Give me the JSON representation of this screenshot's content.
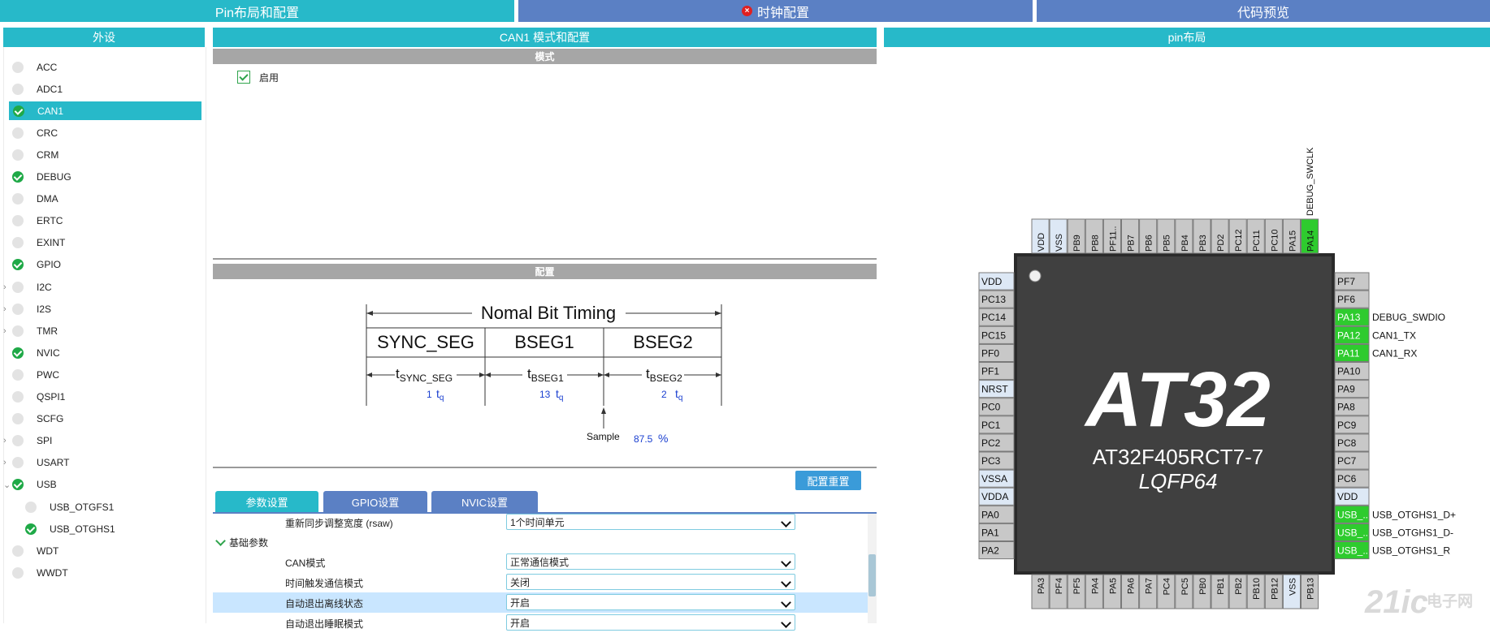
{
  "top_tabs": {
    "pin_layout": "Pin布局和配置",
    "clock_config": "时钟配置",
    "code_preview": "代码预览"
  },
  "left_panel": {
    "title": "外设",
    "items": [
      {
        "label": "ACC",
        "status": "none"
      },
      {
        "label": "ADC1",
        "status": "none"
      },
      {
        "label": "CAN1",
        "status": "ok"
      },
      {
        "label": "CRC",
        "status": "none"
      },
      {
        "label": "CRM",
        "status": "none"
      },
      {
        "label": "DEBUG",
        "status": "ok"
      },
      {
        "label": "DMA",
        "status": "none"
      },
      {
        "label": "ERTC",
        "status": "none"
      },
      {
        "label": "EXINT",
        "status": "none"
      },
      {
        "label": "GPIO",
        "status": "ok"
      },
      {
        "label": "I2C",
        "status": "none"
      },
      {
        "label": "I2S",
        "status": "none"
      },
      {
        "label": "TMR",
        "status": "none"
      },
      {
        "label": "NVIC",
        "status": "ok"
      },
      {
        "label": "PWC",
        "status": "none"
      },
      {
        "label": "QSPI1",
        "status": "none"
      },
      {
        "label": "SCFG",
        "status": "none"
      },
      {
        "label": "SPI",
        "status": "none"
      },
      {
        "label": "USART",
        "status": "none"
      },
      {
        "label": "USB",
        "status": "ok"
      },
      {
        "label": "USB_OTGFS1",
        "status": "none"
      },
      {
        "label": "USB_OTGHS1",
        "status": "ok"
      },
      {
        "label": "WDT",
        "status": "none"
      },
      {
        "label": "WWDT",
        "status": "none"
      }
    ]
  },
  "middle_panel": {
    "title": "CAN1 模式和配置",
    "mode_section": "模式",
    "enable_label": "启用",
    "config_section": "配置",
    "timing": {
      "title": "Nomal Bit Timing",
      "seg1": "SYNC_SEG",
      "seg2": "BSEG1",
      "seg3": "BSEG2",
      "t": "t",
      "sub1": "SYNC_SEG",
      "sub2": "BSEG1",
      "sub3": "BSEG2",
      "tq_t": "t",
      "tq_q": "q",
      "v1": "1",
      "v2": "13",
      "v3": "2",
      "sample_label": "Sample",
      "sample_value": "87.5",
      "percent": "%"
    },
    "reset_button": "配置重置",
    "sub_tabs": {
      "params": "参数设置",
      "gpio": "GPIO设置",
      "nvic": "NVIC设置"
    },
    "group_basic": "基础参数",
    "rows": [
      {
        "label": "重新同步调整宽度 (rsaw)",
        "value": "1个时间单元"
      },
      {
        "label": "CAN模式",
        "value": "正常通信模式"
      },
      {
        "label": "时间触发通信模式",
        "value": "关闭"
      },
      {
        "label": "自动退出离线状态",
        "value": "开启"
      },
      {
        "label": "自动退出睡眠模式",
        "value": "开启"
      }
    ]
  },
  "right_panel": {
    "title": "pin布局",
    "chip_logo": "AT32",
    "chip_name": "AT32F405RCT7-7",
    "chip_pkg": "LQFP64",
    "top_pins": [
      "VDD",
      "VSS",
      "PB9",
      "PB8",
      "PF11..",
      "PB7",
      "PB6",
      "PB5",
      "PB4",
      "PB3",
      "PD2",
      "PC12",
      "PC11",
      "PC10",
      "PA15",
      "PA14"
    ],
    "top_pin_label_pa14": "DEBUG_SWCLK",
    "left_pins": [
      "VDD",
      "PC13",
      "PC14",
      "PC15",
      "PF0",
      "PF1",
      "NRST",
      "PC0",
      "PC1",
      "PC2",
      "PC3",
      "VSSA",
      "VDDA",
      "PA0",
      "PA1",
      "PA2"
    ],
    "right_pins": [
      "PF7",
      "PF6",
      "PA13",
      "PA12",
      "PA11",
      "PA10",
      "PA9",
      "PA8",
      "PC9",
      "PC8",
      "PC7",
      "PC6",
      "VDD",
      "USB_..",
      "USB_..",
      "USB_.."
    ],
    "right_pin_labels": [
      "",
      "",
      "DEBUG_SWDIO",
      "CAN1_TX",
      "CAN1_RX",
      "",
      "",
      "",
      "",
      "",
      "",
      "",
      "",
      "USB_OTGHS1_D+",
      "USB_OTGHS1_D-",
      "USB_OTGHS1_R"
    ],
    "bottom_pins": [
      "PA3",
      "PF4",
      "PF5",
      "PA4",
      "PA5",
      "PA6",
      "PA7",
      "PC4",
      "PC5",
      "PB0",
      "PB1",
      "PB2",
      "PB10",
      "PB12",
      "VSS",
      "PB13"
    ],
    "watermark_main": "21ic",
    "watermark_cn": "电子网",
    "colors": {
      "assigned": "#2ecb2e",
      "power": "#dde8f5",
      "gpio": "#c8c8c8",
      "chip": "#404040"
    }
  }
}
